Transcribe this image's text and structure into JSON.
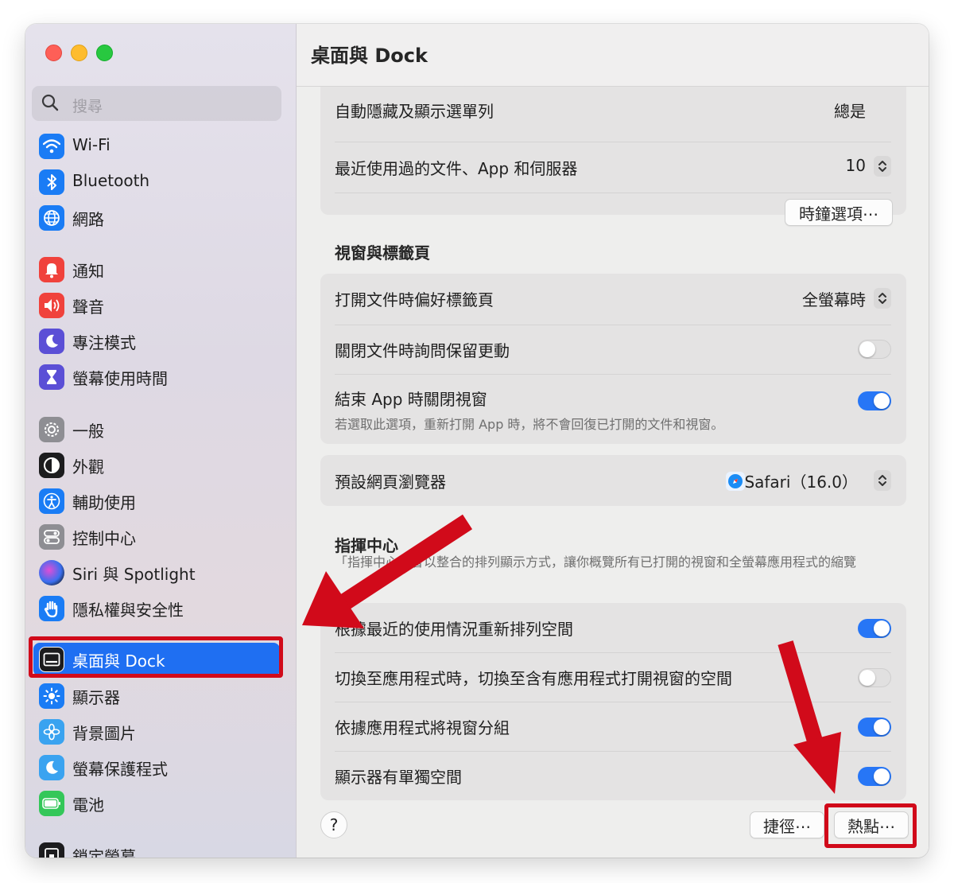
{
  "window": {
    "title": "桌面與 Dock"
  },
  "search": {
    "placeholder": "搜尋"
  },
  "sidebar": {
    "items": [
      {
        "label": "Wi-Fi",
        "icon": "wifi-icon",
        "color": "#1a7cf5"
      },
      {
        "label": "Bluetooth",
        "icon": "bluetooth-icon",
        "color": "#1a7cf5"
      },
      {
        "label": "網路",
        "icon": "globe-icon",
        "color": "#1a7cf5"
      },
      {
        "label": "通知",
        "icon": "bell-icon",
        "color": "#f0423c"
      },
      {
        "label": "聲音",
        "icon": "speaker-icon",
        "color": "#f0423c"
      },
      {
        "label": "專注模式",
        "icon": "moon-icon",
        "color": "#5b4fd6"
      },
      {
        "label": "螢幕使用時間",
        "icon": "hourglass-icon",
        "color": "#5b4fd6"
      },
      {
        "label": "一般",
        "icon": "gear-icon",
        "color": "#8e8e93"
      },
      {
        "label": "外觀",
        "icon": "appearance-icon",
        "color": "#1c1c1e"
      },
      {
        "label": "輔助使用",
        "icon": "accessibility-icon",
        "color": "#1a7cf5"
      },
      {
        "label": "控制中心",
        "icon": "control-center-icon",
        "color": "#8e8e93"
      },
      {
        "label": "Siri 與 Spotlight",
        "icon": "siri-icon",
        "color": "#2b2b5e"
      },
      {
        "label": "隱私權與安全性",
        "icon": "hand-icon",
        "color": "#1a7cf5"
      },
      {
        "label": "桌面與 Dock",
        "icon": "dock-icon",
        "color": "#1c1c1e",
        "selected": true
      },
      {
        "label": "顯示器",
        "icon": "sun-icon",
        "color": "#1a7cf5"
      },
      {
        "label": "背景圖片",
        "icon": "flower-icon",
        "color": "#3aa3f0"
      },
      {
        "label": "螢幕保護程式",
        "icon": "screensaver-icon",
        "color": "#3aa3f0"
      },
      {
        "label": "電池",
        "icon": "battery-icon",
        "color": "#34c759"
      },
      {
        "label": "鎖定螢幕",
        "icon": "lock-screen-icon",
        "color": "#1c1c1e"
      }
    ]
  },
  "menu_bar_group": {
    "partial_label": "自動隱藏及顯示選單列",
    "partial_value": "總是",
    "recent_label": "最近使用過的文件、App 和伺服器",
    "recent_value": "10",
    "clock_button": "時鐘選項⋯"
  },
  "windows_section": {
    "title": "視窗與標籤頁",
    "prefer_tabs_label": "打開文件時偏好標籤頁",
    "prefer_tabs_value": "全螢幕時",
    "ask_keep_label": "關閉文件時詢問保留更動",
    "ask_keep_on": false,
    "close_windows_label": "結束 App 時關閉視窗",
    "close_windows_sub": "若選取此選項，重新打開 App 時，將不會回復已打開的文件和視窗。",
    "close_windows_on": true
  },
  "browser": {
    "label": "預設網頁瀏覽器",
    "value": "Safari（16.0）"
  },
  "mission_control": {
    "title": "指揮中心",
    "description": "「指揮中心」會以整合的排列顯示方式，讓你概覽所有已打開的視窗和全螢幕應用程式的縮覽",
    "items": [
      {
        "label": "根據最近的使用情況重新排列空間",
        "on": true
      },
      {
        "label": "切換至應用程式時，切換至含有應用程式打開視窗的空間",
        "on": false
      },
      {
        "label": "依據應用程式將視窗分組",
        "on": true
      },
      {
        "label": "顯示器有單獨空間",
        "on": true
      }
    ]
  },
  "footer": {
    "help": "?",
    "shortcuts_button": "捷徑⋯",
    "hot_corners_button": "熱點⋯"
  },
  "colors": {
    "accent": "#1f6ff2",
    "annotation_red": "#d10a1a"
  }
}
